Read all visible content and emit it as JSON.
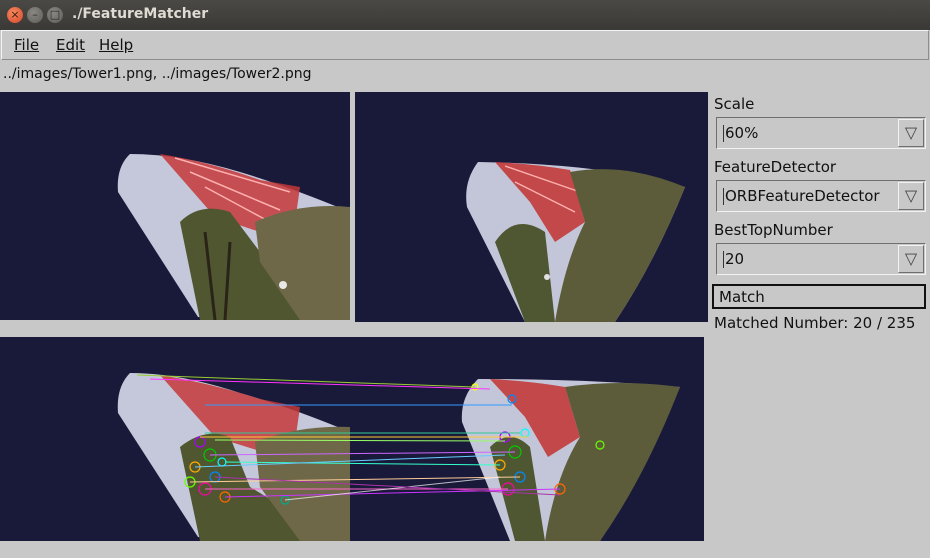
{
  "window": {
    "title": "./FeatureMatcher"
  },
  "menu": {
    "file": "File",
    "edit": "Edit",
    "help": "Help"
  },
  "path_label": "../images/Tower1.png, ../images/Tower2.png",
  "controls": {
    "scale": {
      "label": "Scale",
      "value": "60%"
    },
    "detector": {
      "label": "FeatureDetector",
      "value": "ORBFeatureDetector"
    },
    "best_top": {
      "label": "BestTopNumber",
      "value": "20"
    },
    "match_button": "Match",
    "matched_status": "Matched Number: 20 / 235"
  },
  "icons": {
    "close": "close-icon",
    "minimize": "minimize-icon",
    "maximize": "maximize-icon",
    "dropdown": "dropdown-arrow-icon"
  },
  "colors": {
    "image_background": "#191a3a",
    "window_background": "#c8c8c8",
    "titlebar": "#3e3d39"
  }
}
